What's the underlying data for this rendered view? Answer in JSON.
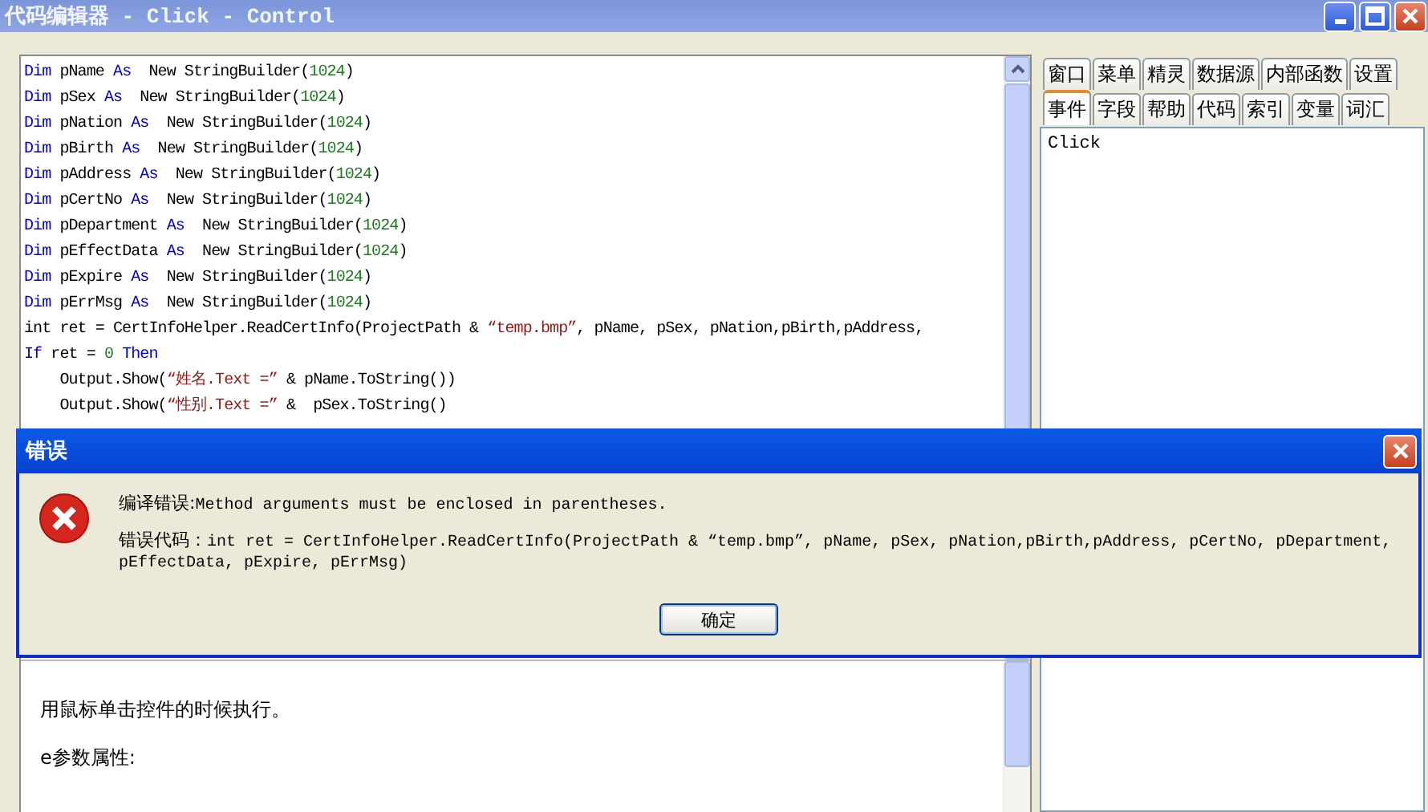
{
  "window": {
    "title": "代码编辑器 - Click - Control"
  },
  "code_lines": [
    [
      {
        "kind": "kw",
        "text": "Dim"
      },
      {
        "kind": "plain",
        "text": " pName "
      },
      {
        "kind": "kw",
        "text": "As"
      },
      {
        "kind": "plain",
        "text": "  New StringBuilder("
      },
      {
        "kind": "num",
        "text": "1024"
      },
      {
        "kind": "plain",
        "text": ")"
      }
    ],
    [
      {
        "kind": "kw",
        "text": "Dim"
      },
      {
        "kind": "plain",
        "text": " pSex "
      },
      {
        "kind": "kw",
        "text": "As"
      },
      {
        "kind": "plain",
        "text": "  New StringBuilder("
      },
      {
        "kind": "num",
        "text": "1024"
      },
      {
        "kind": "plain",
        "text": ")"
      }
    ],
    [
      {
        "kind": "kw",
        "text": "Dim"
      },
      {
        "kind": "plain",
        "text": " pNation "
      },
      {
        "kind": "kw",
        "text": "As"
      },
      {
        "kind": "plain",
        "text": "  New StringBuilder("
      },
      {
        "kind": "num",
        "text": "1024"
      },
      {
        "kind": "plain",
        "text": ")"
      }
    ],
    [
      {
        "kind": "kw",
        "text": "Dim"
      },
      {
        "kind": "plain",
        "text": " pBirth "
      },
      {
        "kind": "kw",
        "text": "As"
      },
      {
        "kind": "plain",
        "text": "  New StringBuilder("
      },
      {
        "kind": "num",
        "text": "1024"
      },
      {
        "kind": "plain",
        "text": ")"
      }
    ],
    [
      {
        "kind": "kw",
        "text": "Dim"
      },
      {
        "kind": "plain",
        "text": " pAddress "
      },
      {
        "kind": "kw",
        "text": "As"
      },
      {
        "kind": "plain",
        "text": "  New StringBuilder("
      },
      {
        "kind": "num",
        "text": "1024"
      },
      {
        "kind": "plain",
        "text": ")"
      }
    ],
    [
      {
        "kind": "kw",
        "text": "Dim"
      },
      {
        "kind": "plain",
        "text": " pCertNo "
      },
      {
        "kind": "kw",
        "text": "As"
      },
      {
        "kind": "plain",
        "text": "  New StringBuilder("
      },
      {
        "kind": "num",
        "text": "1024"
      },
      {
        "kind": "plain",
        "text": ")"
      }
    ],
    [
      {
        "kind": "kw",
        "text": "Dim"
      },
      {
        "kind": "plain",
        "text": " pDepartment "
      },
      {
        "kind": "kw",
        "text": "As"
      },
      {
        "kind": "plain",
        "text": "  New StringBuilder("
      },
      {
        "kind": "num",
        "text": "1024"
      },
      {
        "kind": "plain",
        "text": ")"
      }
    ],
    [
      {
        "kind": "kw",
        "text": "Dim"
      },
      {
        "kind": "plain",
        "text": " pEffectData "
      },
      {
        "kind": "kw",
        "text": "As"
      },
      {
        "kind": "plain",
        "text": "  New StringBuilder("
      },
      {
        "kind": "num",
        "text": "1024"
      },
      {
        "kind": "plain",
        "text": ")"
      }
    ],
    [
      {
        "kind": "kw",
        "text": "Dim"
      },
      {
        "kind": "plain",
        "text": " pExpire "
      },
      {
        "kind": "kw",
        "text": "As"
      },
      {
        "kind": "plain",
        "text": "  New StringBuilder("
      },
      {
        "kind": "num",
        "text": "1024"
      },
      {
        "kind": "plain",
        "text": ")"
      }
    ],
    [
      {
        "kind": "kw",
        "text": "Dim"
      },
      {
        "kind": "plain",
        "text": " pErrMsg "
      },
      {
        "kind": "kw",
        "text": "As"
      },
      {
        "kind": "plain",
        "text": "  New StringBuilder("
      },
      {
        "kind": "num",
        "text": "1024"
      },
      {
        "kind": "plain",
        "text": ")"
      }
    ],
    [
      {
        "kind": "plain",
        "text": "int ret = CertInfoHelper.ReadCertInfo(ProjectPath & "
      },
      {
        "kind": "str",
        "text": "“temp.bmp”"
      },
      {
        "kind": "plain",
        "text": ", pName, pSex, pNation,pBirth,pAddress,"
      }
    ],
    [
      {
        "kind": "kw",
        "text": "If"
      },
      {
        "kind": "plain",
        "text": " ret = "
      },
      {
        "kind": "num",
        "text": "0"
      },
      {
        "kind": "kw",
        "text": " Then"
      }
    ],
    [
      {
        "kind": "plain",
        "text": "    Output.Show("
      },
      {
        "kind": "str",
        "text": "“姓名.Text =”"
      },
      {
        "kind": "plain",
        "text": " & pName.ToString())"
      }
    ],
    [
      {
        "kind": "plain",
        "text": "    Output.Show("
      },
      {
        "kind": "str",
        "text": "“性别.Text =”"
      },
      {
        "kind": "plain",
        "text": " &  pSex.ToString()"
      }
    ]
  ],
  "help_lines": [
    "用鼠标单击控件的时候执行。",
    "e参数属性:"
  ],
  "tab_rows": [
    [
      {
        "label": "窗口",
        "selected": false
      },
      {
        "label": "菜单",
        "selected": false
      },
      {
        "label": "精灵",
        "selected": false
      },
      {
        "label": "数据源",
        "selected": false
      },
      {
        "label": "内部函数",
        "selected": false
      },
      {
        "label": "设置",
        "selected": false
      }
    ],
    [
      {
        "label": "事件",
        "selected": true
      },
      {
        "label": "字段",
        "selected": false
      },
      {
        "label": "帮助",
        "selected": false
      },
      {
        "label": "代码",
        "selected": false
      },
      {
        "label": "索引",
        "selected": false
      },
      {
        "label": "变量",
        "selected": false
      },
      {
        "label": "词汇",
        "selected": false
      }
    ]
  ],
  "event_list": [
    {
      "label": "Click"
    }
  ],
  "dialog": {
    "title": "错误",
    "message_label": "编译错误:",
    "message": "Method arguments must be enclosed in parentheses.",
    "code_label": "错误代码：",
    "code": "int ret = CertInfoHelper.ReadCertInfo(ProjectPath & “temp.bmp”, pName, pSex, pNation,pBirth,pAddress, pCertNo, pDepartment, pEffectData, pExpire, pErrMsg)",
    "button": "确定"
  }
}
